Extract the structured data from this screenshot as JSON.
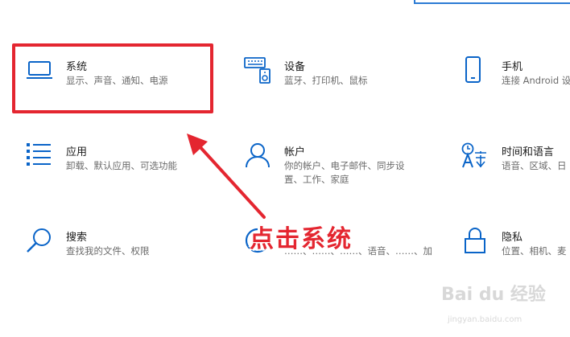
{
  "settings": {
    "tiles": [
      {
        "title": "系统",
        "subtitle": [
          "显示、声音、通知、电源"
        ],
        "icon": "laptop-icon"
      },
      {
        "title": "设备",
        "subtitle": [
          "蓝牙、打印机、鼠标"
        ],
        "icon": "keyboard-speaker-icon"
      },
      {
        "title": "手机",
        "subtitle": [
          "连接 Android 设"
        ],
        "icon": "phone-icon"
      },
      {
        "title": "应用",
        "subtitle": [
          "卸载、默认应用、可选功能"
        ],
        "icon": "apps-list-icon"
      },
      {
        "title": "帐户",
        "subtitle": [
          "你的帐户、电子邮件、同步设",
          "置、工作、家庭"
        ],
        "icon": "person-icon"
      },
      {
        "title": "时间和语言",
        "subtitle": [
          "语音、区域、日"
        ],
        "icon": "time-language-icon"
      },
      {
        "title": "搜索",
        "subtitle": [
          "查找我的文件、权限"
        ],
        "icon": "search-icon"
      },
      {
        "title": "",
        "subtitle": [
          "……、……、……、语音、……、加"
        ],
        "icon": "ease-of-access-icon"
      },
      {
        "title": "隐私",
        "subtitle": [
          "位置、相机、麦"
        ],
        "icon": "lock-icon"
      }
    ]
  },
  "annotation": {
    "text": "点击系统",
    "color": "#e42630"
  },
  "watermark": {
    "logo": "Bai du 经验",
    "url": "jingyan.baidu.com"
  },
  "colors": {
    "accent": "#0a64c8",
    "highlight": "#e42630"
  }
}
